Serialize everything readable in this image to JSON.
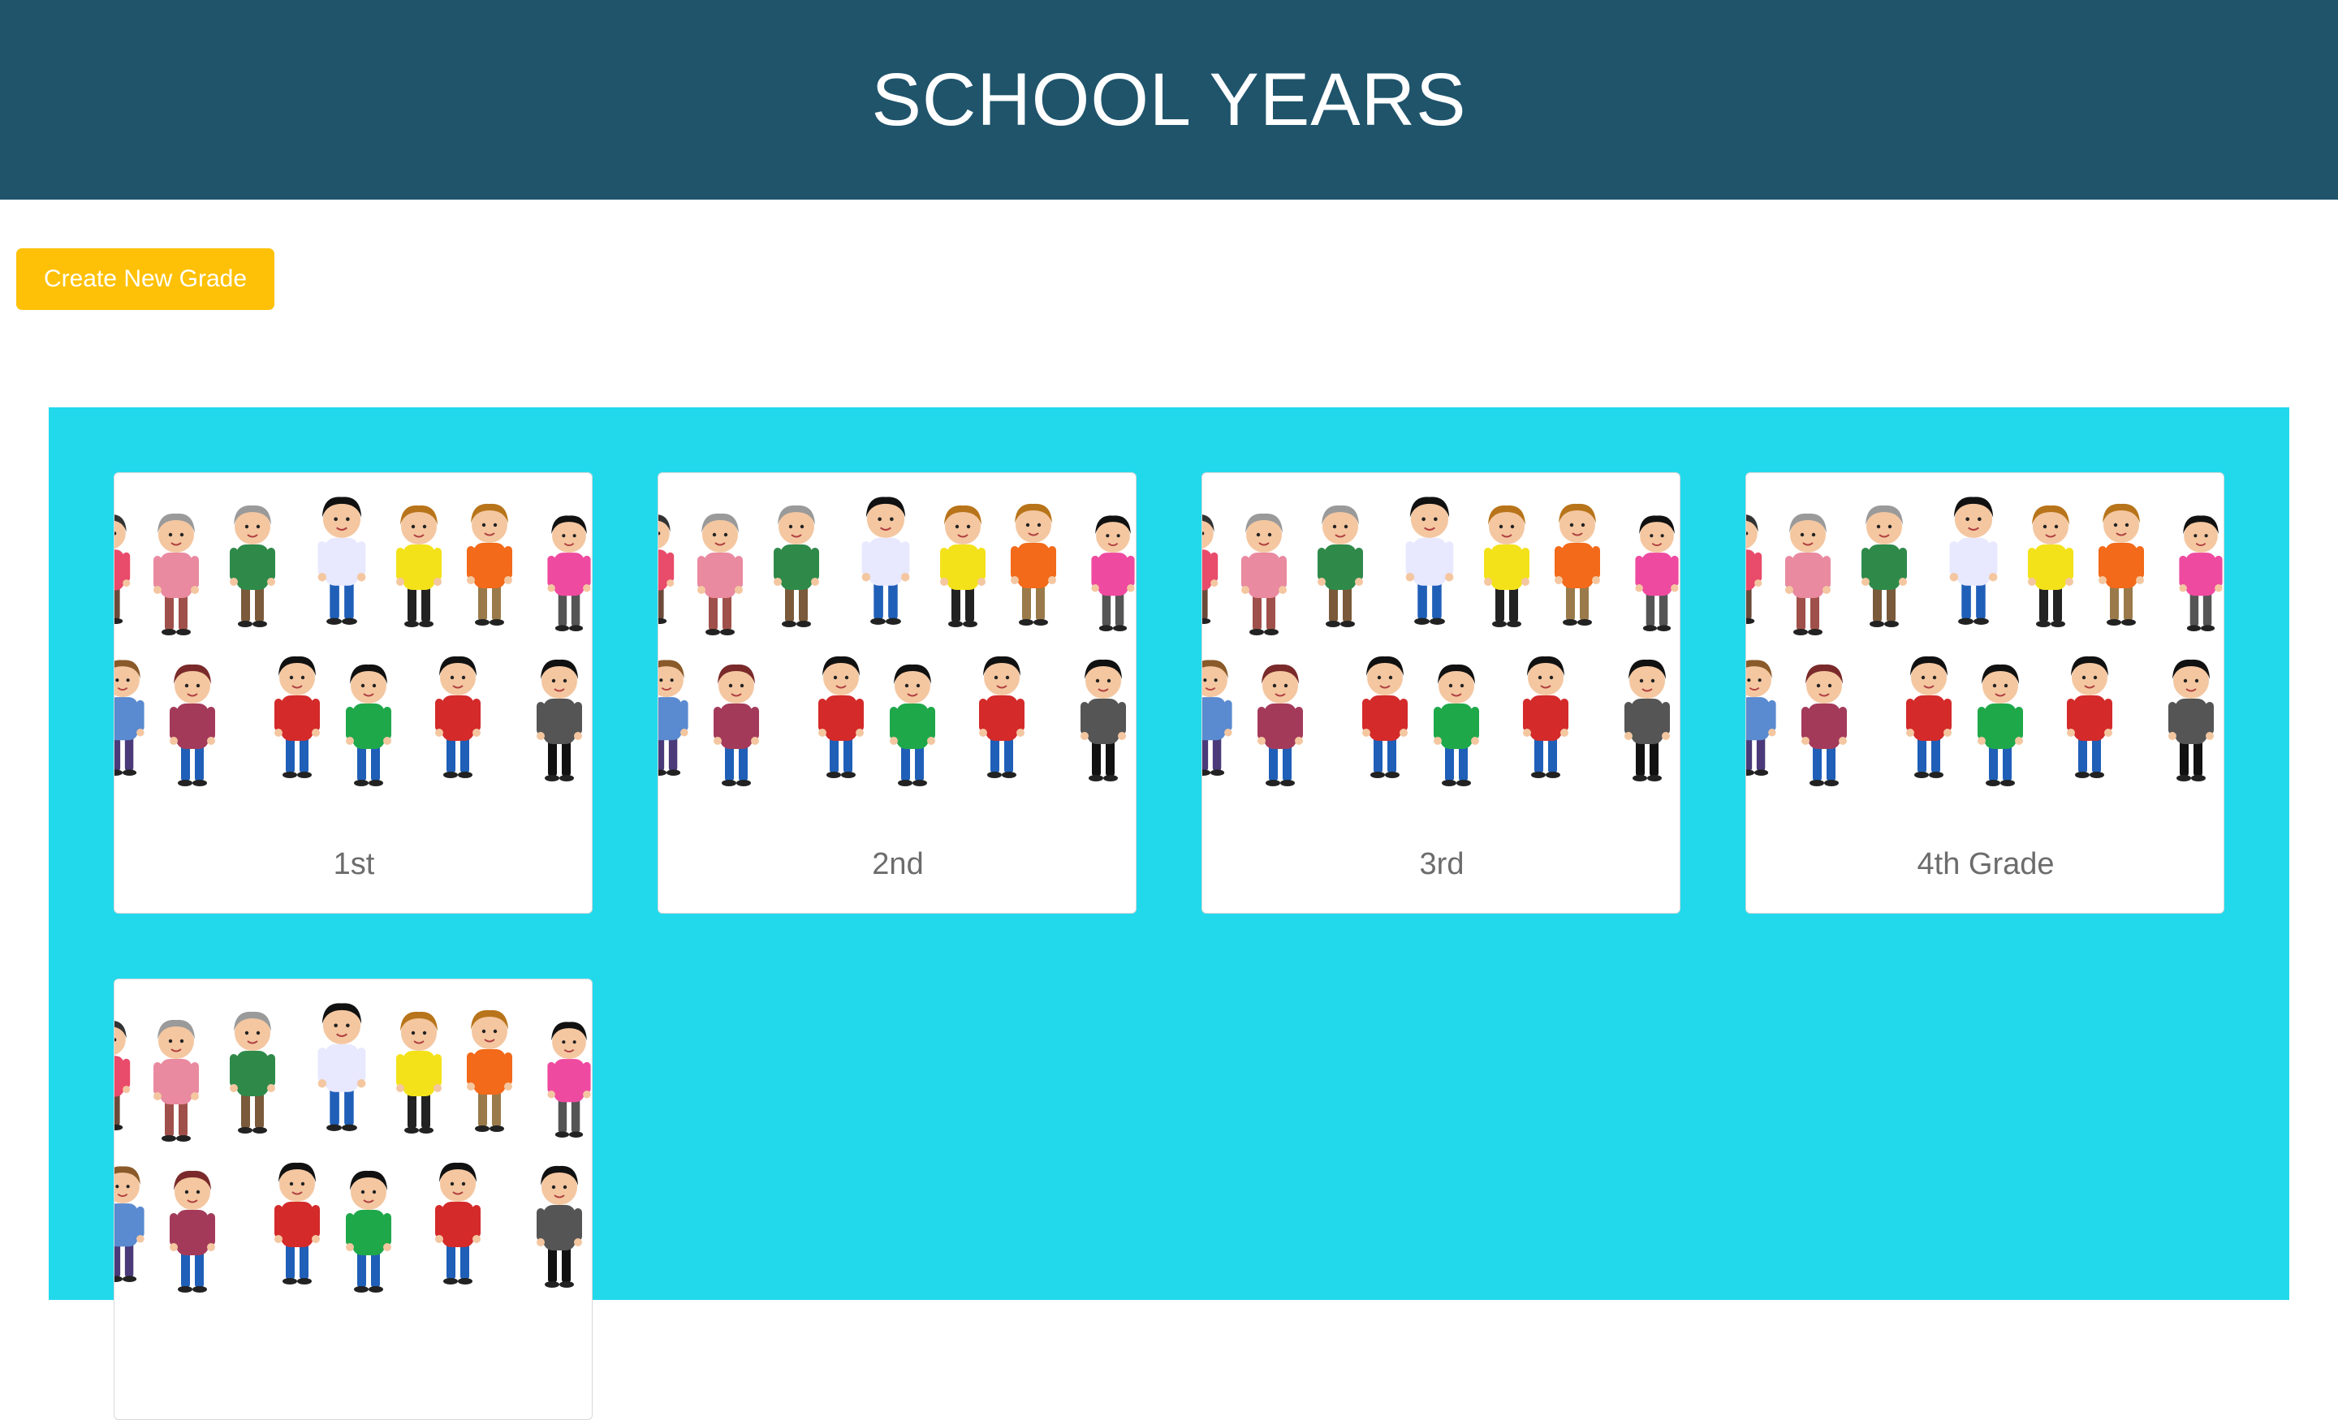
{
  "header": {
    "title": "SCHOOL YEARS",
    "background": "#1f546b"
  },
  "toolbar": {
    "create_label": "Create New Grade",
    "create_color": "#ffc107"
  },
  "panel": {
    "background": "#22d9ec"
  },
  "grades": [
    {
      "label": "1st",
      "image": "people-illustration"
    },
    {
      "label": "2nd",
      "image": "people-illustration"
    },
    {
      "label": "3rd",
      "image": "people-illustration"
    },
    {
      "label": "4th Grade",
      "image": "people-illustration"
    },
    {
      "label": "",
      "image": "people-illustration"
    }
  ]
}
